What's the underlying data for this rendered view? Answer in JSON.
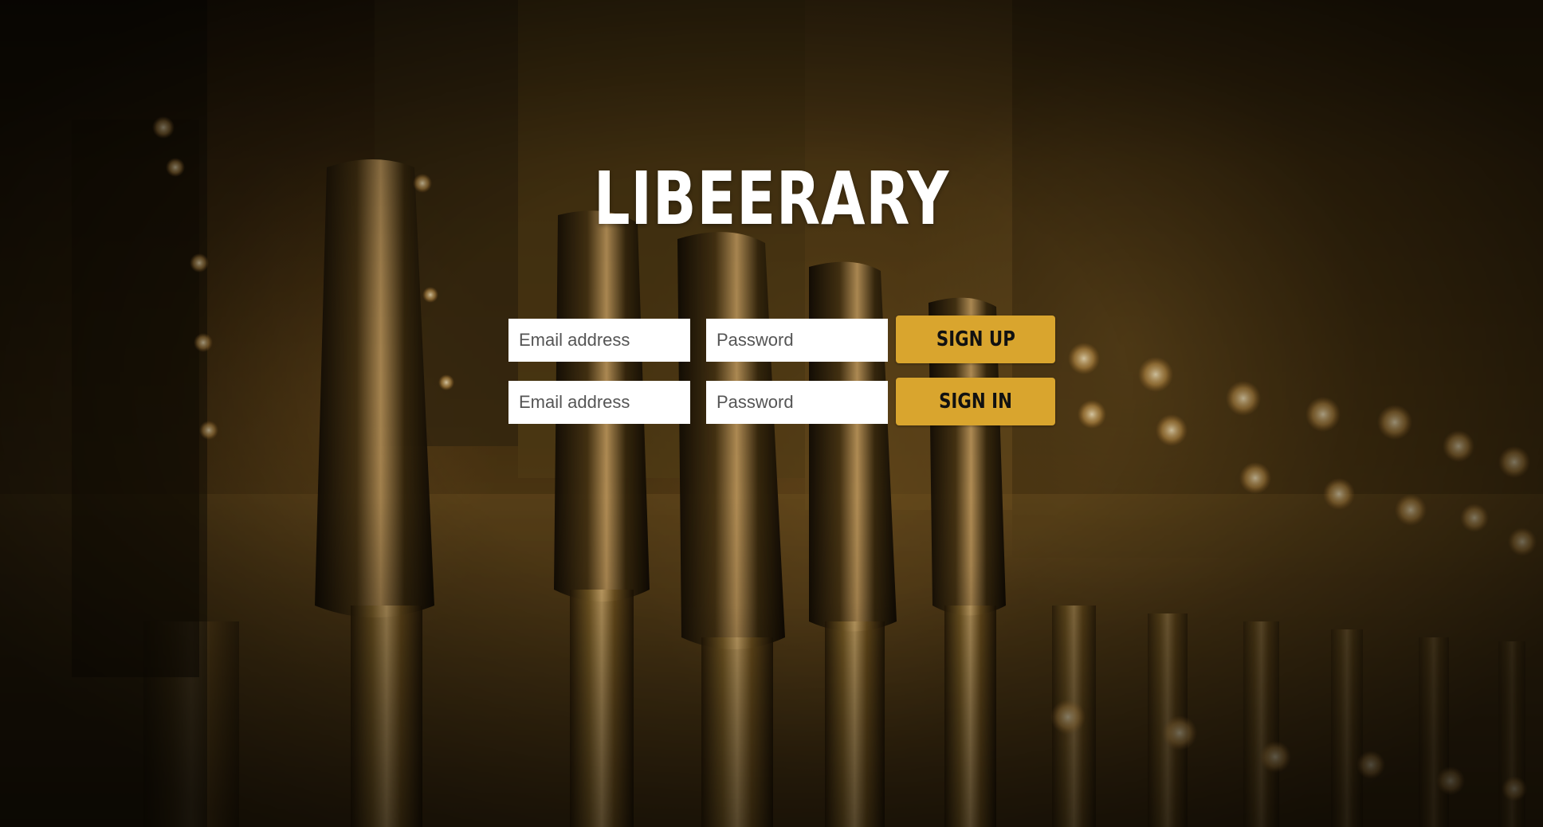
{
  "brand": {
    "logo_text": "LIBEERARY"
  },
  "signup_form": {
    "email_placeholder": "Email address",
    "password_placeholder": "Password",
    "submit_label": "SIGN UP"
  },
  "signin_form": {
    "email_placeholder": "Email address",
    "password_placeholder": "Password",
    "submit_label": "SIGN IN"
  },
  "colors": {
    "accent": "#d9a52e",
    "logo": "#ffffff",
    "field_background": "#ffffff",
    "button_text": "#111111"
  },
  "background": {
    "subject": "row-of-beer-tap-handles-photo"
  }
}
